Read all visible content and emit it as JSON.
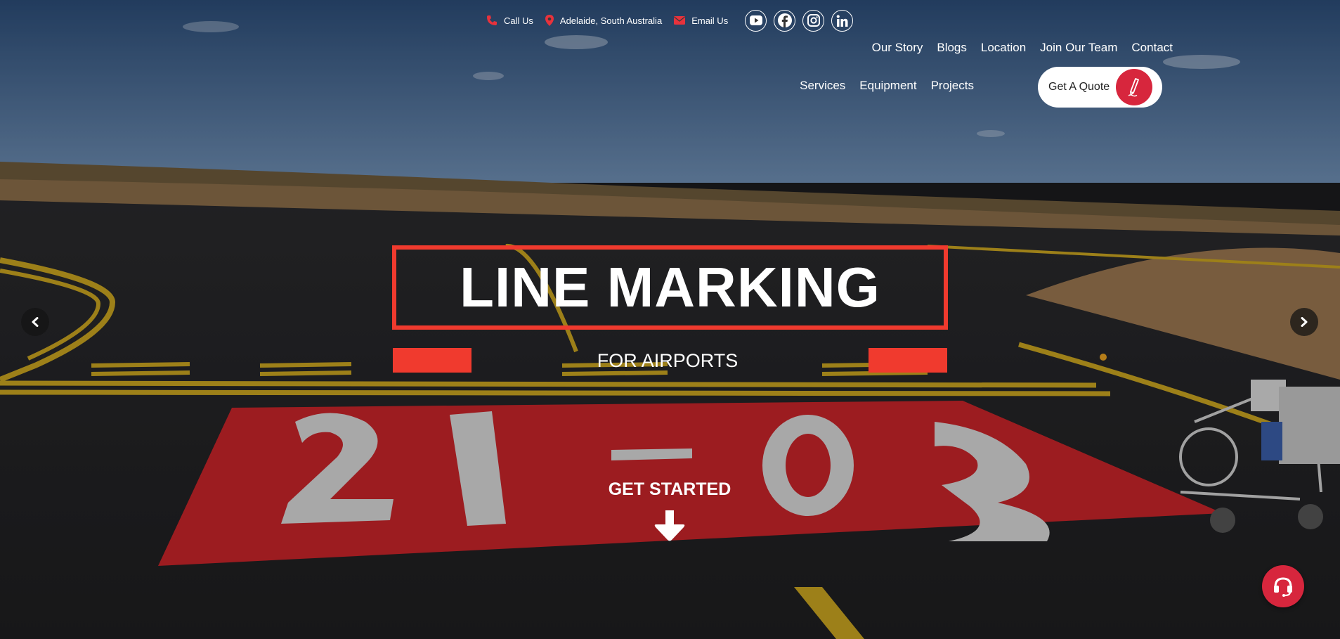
{
  "topbar": {
    "contacts": [
      {
        "label": "Call Us",
        "icon": "phone-icon"
      },
      {
        "label": "Adelaide, South Australia",
        "icon": "map-pin-icon"
      },
      {
        "label": "Email Us",
        "icon": "envelope-icon"
      }
    ],
    "socials": [
      "youtube-icon",
      "facebook-icon",
      "instagram-icon",
      "linkedin-icon"
    ]
  },
  "nav": {
    "row1": [
      "Our Story",
      "Blogs",
      "Location",
      "Join Our Team",
      "Contact"
    ],
    "row2": [
      "Services",
      "Equipment",
      "Projects"
    ],
    "quote_label": "Get A Quote"
  },
  "hero": {
    "headline": "LINE MARKING",
    "subtitle": "FOR AIRPORTS",
    "cta": "GET STARTED"
  },
  "colors": {
    "accent_red": "#f03a2e",
    "button_red": "#d7263d",
    "icon_red": "#e8323c"
  }
}
